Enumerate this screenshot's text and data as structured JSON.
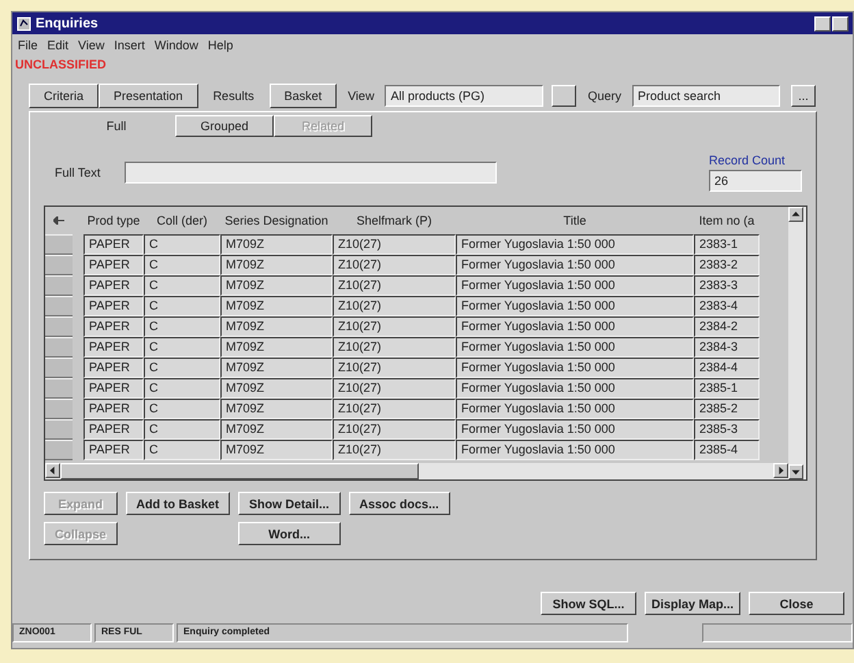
{
  "window": {
    "title": "Enquiries"
  },
  "menu": [
    "File",
    "Edit",
    "View",
    "Insert",
    "Window",
    "Help"
  ],
  "classification": "UNCLASSIFIED",
  "tabs": [
    {
      "label": "Criteria",
      "selected": false
    },
    {
      "label": "Presentation",
      "selected": false
    },
    {
      "label": "Results",
      "selected": true
    },
    {
      "label": "Basket",
      "selected": false
    }
  ],
  "view": {
    "label": "View",
    "value": "All products (PG)"
  },
  "query": {
    "label": "Query",
    "value": "Product search",
    "button": "..."
  },
  "subtabs": [
    {
      "label": "Full",
      "selected": true,
      "disabled": false
    },
    {
      "label": "Grouped",
      "selected": false,
      "disabled": false
    },
    {
      "label": "Related",
      "selected": false,
      "disabled": true
    }
  ],
  "full_text": {
    "label": "Full Text"
  },
  "record_count": {
    "label": "Record Count",
    "value": "26"
  },
  "table": {
    "columns": [
      "Prod type",
      "Coll (der)",
      "Series Designation",
      "Shelfmark (P)",
      "Title",
      "Item no (a"
    ],
    "rows": [
      [
        "PAPER",
        "C",
        "M709Z",
        "Z10(27)",
        "Former Yugoslavia 1:50 000",
        "2383-1"
      ],
      [
        "PAPER",
        "C",
        "M709Z",
        "Z10(27)",
        "Former Yugoslavia 1:50 000",
        "2383-2"
      ],
      [
        "PAPER",
        "C",
        "M709Z",
        "Z10(27)",
        "Former Yugoslavia 1:50 000",
        "2383-3"
      ],
      [
        "PAPER",
        "C",
        "M709Z",
        "Z10(27)",
        "Former Yugoslavia 1:50 000",
        "2383-4"
      ],
      [
        "PAPER",
        "C",
        "M709Z",
        "Z10(27)",
        "Former Yugoslavia 1:50 000",
        "2384-2"
      ],
      [
        "PAPER",
        "C",
        "M709Z",
        "Z10(27)",
        "Former Yugoslavia 1:50 000",
        "2384-3"
      ],
      [
        "PAPER",
        "C",
        "M709Z",
        "Z10(27)",
        "Former Yugoslavia 1:50 000",
        "2384-4"
      ],
      [
        "PAPER",
        "C",
        "M709Z",
        "Z10(27)",
        "Former Yugoslavia 1:50 000",
        "2385-1"
      ],
      [
        "PAPER",
        "C",
        "M709Z",
        "Z10(27)",
        "Former Yugoslavia 1:50 000",
        "2385-2"
      ],
      [
        "PAPER",
        "C",
        "M709Z",
        "Z10(27)",
        "Former Yugoslavia 1:50 000",
        "2385-3"
      ],
      [
        "PAPER",
        "C",
        "M709Z",
        "Z10(27)",
        "Former Yugoslavia 1:50 000",
        "2385-4"
      ]
    ]
  },
  "actions": [
    {
      "label": "Expand",
      "disabled": true
    },
    {
      "label": "Add to Basket",
      "disabled": false
    },
    {
      "label": "Show Detail...",
      "disabled": false
    },
    {
      "label": "Assoc docs...",
      "disabled": false
    },
    {
      "label": "Collapse",
      "disabled": true
    },
    {
      "label": "Word...",
      "disabled": false
    }
  ],
  "bottom_buttons": [
    "Show SQL...",
    "Display Map...",
    "Close"
  ],
  "status_bar": [
    "ZNO001",
    "RES FUL",
    "Enquiry completed"
  ]
}
